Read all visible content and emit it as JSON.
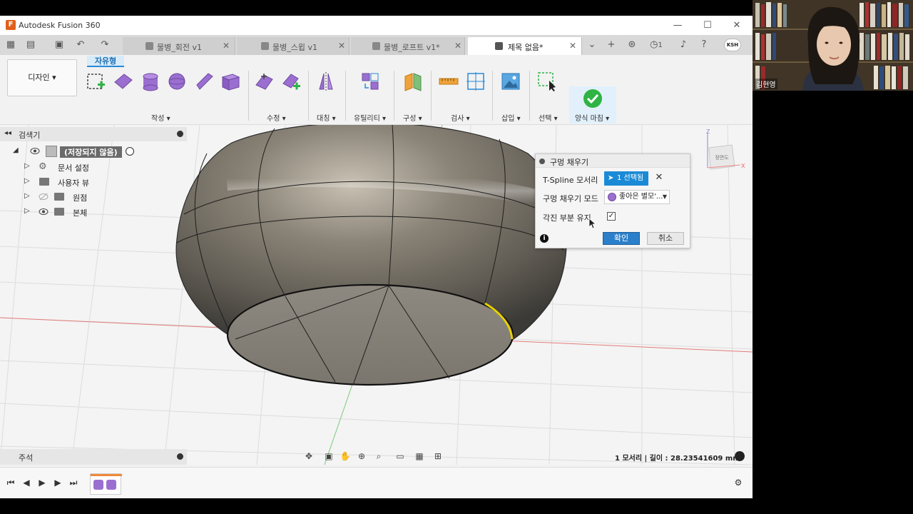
{
  "window": {
    "app_title": "Autodesk Fusion 360",
    "controls": [
      "—",
      "☐",
      "✕"
    ]
  },
  "tabs": [
    {
      "label": "물병_회전 v1",
      "active": false
    },
    {
      "label": "물병_스윕 v1",
      "active": false
    },
    {
      "label": "물병_로프트 v1*",
      "active": false
    },
    {
      "label": "제목 없음*",
      "active": true
    }
  ],
  "tabbar_right": {
    "jobs_count": "1",
    "user_initials": "KSH"
  },
  "toolbar": {
    "workspace_label": "디자인 ▾",
    "active_tab": "자유형",
    "groups": [
      {
        "key": "create",
        "label": "작성 ▾"
      },
      {
        "key": "modify",
        "label": "수정 ▾"
      },
      {
        "key": "symmetry",
        "label": "대칭 ▾"
      },
      {
        "key": "utilities",
        "label": "유틸리티 ▾"
      },
      {
        "key": "construct",
        "label": "구성 ▾"
      },
      {
        "key": "inspect",
        "label": "검사 ▾"
      },
      {
        "key": "insert",
        "label": "삽입 ▾"
      },
      {
        "key": "select",
        "label": "선택 ▾"
      },
      {
        "key": "finish",
        "label": "양식 마침 ▾"
      }
    ]
  },
  "browser": {
    "title": "검색기",
    "root": "(저장되지 않음)",
    "items": [
      "문서 설정",
      "사용자 뷰",
      "원점",
      "본체"
    ]
  },
  "dialog": {
    "title": "구멍 채우기",
    "row1_label": "T-Spline 모서리",
    "row1_value": "1 선택됨",
    "row2_label": "구멍 채우기 모드",
    "row2_value": "좋아은 별모'...",
    "row3_label": "각진 부분 유지",
    "row3_checked": true,
    "ok": "확인",
    "cancel": "취소"
  },
  "viewcube_label": "정면도",
  "comments_label": "주석",
  "status_text": "1 모서리 | 길이 : 28.23541609 mm",
  "webcam": {
    "participant_name": "김현영"
  },
  "colors": {
    "accent_blue": "#1b8ad6",
    "finish_green": "#2fb344",
    "tool_purple": "#9b6fd0",
    "selected_edge": "#e6d000"
  }
}
